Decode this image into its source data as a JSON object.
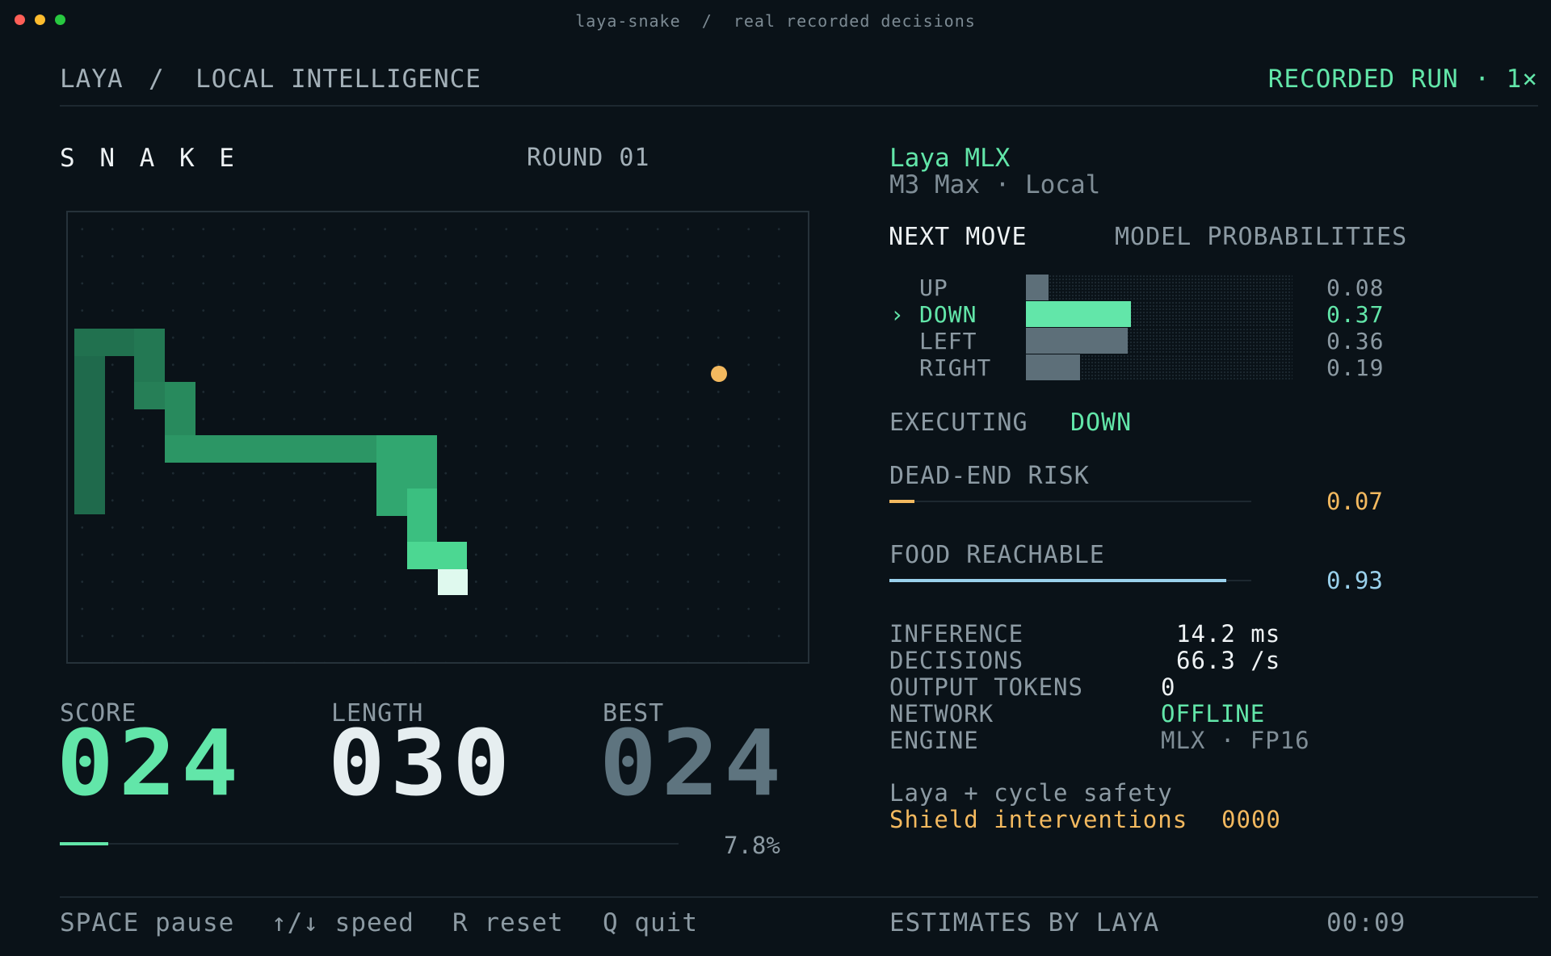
{
  "window": {
    "title": "laya-snake  /  real recorded decisions"
  },
  "header": {
    "brand": "LAYA",
    "sep": "/",
    "section": "LOCAL INTELLIGENCE",
    "run_status": "RECORDED RUN · 1×"
  },
  "game": {
    "title": "S N A K E",
    "round": "ROUND 01",
    "score_label": "SCORE",
    "score": "024",
    "length_label": "LENGTH",
    "length": "030",
    "best_label": "BEST",
    "best": "024",
    "progress": 0.078,
    "progress_text": "7.8%"
  },
  "model": {
    "name": "Laya MLX",
    "hardware": "M3 Max · Local"
  },
  "next_move": {
    "label": "NEXT MOVE",
    "probs_label": "MODEL PROBABILITIES",
    "selected_marker": "›",
    "moves": [
      {
        "name": "UP",
        "prob": 0.08,
        "prob_text": "0.08",
        "selected": false
      },
      {
        "name": "DOWN",
        "prob": 0.37,
        "prob_text": "0.37",
        "selected": true
      },
      {
        "name": "LEFT",
        "prob": 0.36,
        "prob_text": "0.36",
        "selected": false
      },
      {
        "name": "RIGHT",
        "prob": 0.19,
        "prob_text": "0.19",
        "selected": false
      }
    ]
  },
  "executing": {
    "label": "EXECUTING",
    "value": "DOWN"
  },
  "dead_end": {
    "label": "DEAD-END RISK",
    "value": 0.07,
    "value_text": "0.07"
  },
  "food_reachable": {
    "label": "FOOD REACHABLE",
    "value": 0.93,
    "value_text": "0.93"
  },
  "stats": {
    "inference_label": "INFERENCE",
    "inference": "14.2 ms",
    "decisions_label": "DECISIONS",
    "decisions": "66.3 /s",
    "tokens_label": "OUTPUT TOKENS",
    "tokens": "0",
    "network_label": "NETWORK",
    "network": "OFFLINE",
    "engine_label": "ENGINE",
    "engine": "MLX · FP16"
  },
  "safety": {
    "line1": "Laya + cycle safety",
    "shield_label": "Shield interventions",
    "shield_value": "0000"
  },
  "footer": {
    "space": "SPACE pause",
    "speed": "↑/↓ speed",
    "reset": "R reset",
    "quit": "Q quit",
    "estimates": "ESTIMATES BY LAYA",
    "time": "00:09"
  },
  "colors": {
    "accent": "#62e6a9",
    "amber": "#f3b95f",
    "blue": "#9ad1ec",
    "background": "#0a1218"
  }
}
